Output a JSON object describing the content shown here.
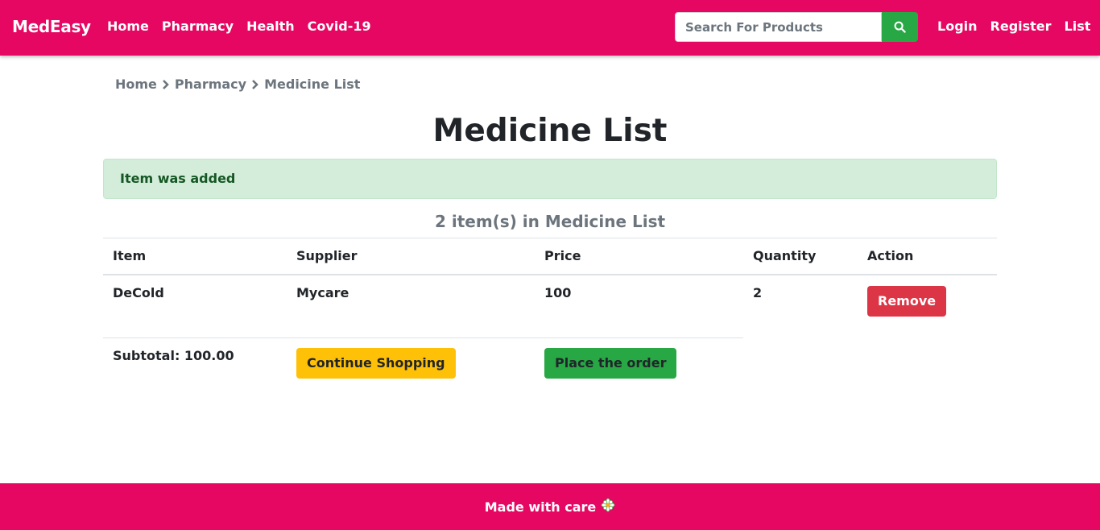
{
  "nav": {
    "brand": "MedEasy",
    "links": [
      "Home",
      "Pharmacy",
      "Health",
      "Covid-19"
    ],
    "search_placeholder": "Search For Products",
    "search_icon": "search-icon",
    "right_links": [
      "Login",
      "Register",
      "List"
    ]
  },
  "breadcrumb": [
    "Home",
    "Pharmacy",
    "Medicine List"
  ],
  "page_title": "Medicine List",
  "alert": "Item was added",
  "count_title": "2 item(s) in Medicine List",
  "table": {
    "headers": [
      "Item",
      "Supplier",
      "Price",
      "Quantity",
      "Action"
    ],
    "rows": [
      {
        "item": "DeCold",
        "supplier": "Mycare",
        "price": "100",
        "quantity": "2",
        "action": "Remove"
      }
    ],
    "subtotal": "Subtotal: 100.00",
    "continue_label": "Continue Shopping",
    "order_label": "Place the order"
  },
  "footer": {
    "text": "Made with care",
    "icon": "flower-icon"
  },
  "colors": {
    "brand": "#e60762",
    "success": "#28a745",
    "danger": "#dc3545",
    "warning": "#ffc107",
    "alert_bg": "#d4edda",
    "alert_text": "#155724"
  }
}
